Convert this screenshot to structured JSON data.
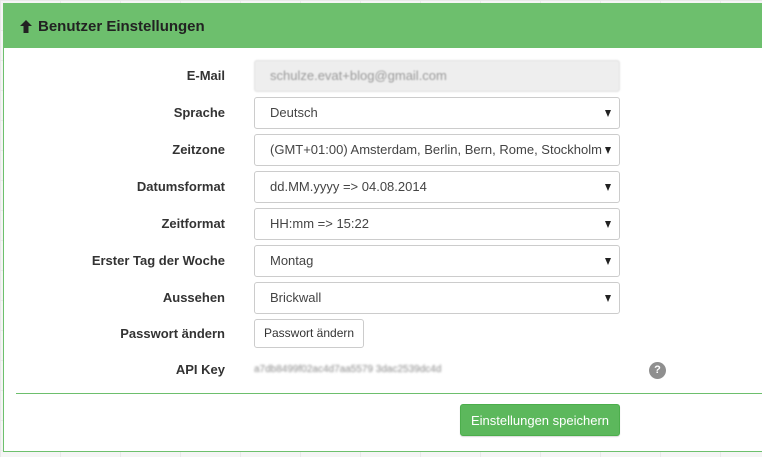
{
  "panel": {
    "title": "Benutzer Einstellungen",
    "icon": "arrow-up-icon",
    "header_color": "#6dbf6d"
  },
  "fields": {
    "email": {
      "label": "E-Mail",
      "value": "schulze.evat+blog@gmail.com"
    },
    "language": {
      "label": "Sprache",
      "value": "Deutsch"
    },
    "timezone": {
      "label": "Zeitzone",
      "value": "(GMT+01:00) Amsterdam, Berlin, Bern, Rome, Stockholm"
    },
    "date_format": {
      "label": "Datumsformat",
      "value": "dd.MM.yyyy => 04.08.2014"
    },
    "time_format": {
      "label": "Zeitformat",
      "value": "HH:mm => 15:22"
    },
    "first_day": {
      "label": "Erster Tag der Woche",
      "value": "Montag"
    },
    "theme": {
      "label": "Aussehen",
      "value": "Brickwall"
    },
    "password": {
      "label": "Passwort ändern",
      "button_label": "Passwort ändern"
    },
    "api_key": {
      "label": "API Key",
      "value": "a7db8499f02ac4d7aa5579 3dac2539dc4d",
      "help_icon": "question-icon",
      "help_glyph": "?"
    }
  },
  "actions": {
    "save_label": "Einstellungen speichern",
    "save_color": "#5cb85c"
  }
}
